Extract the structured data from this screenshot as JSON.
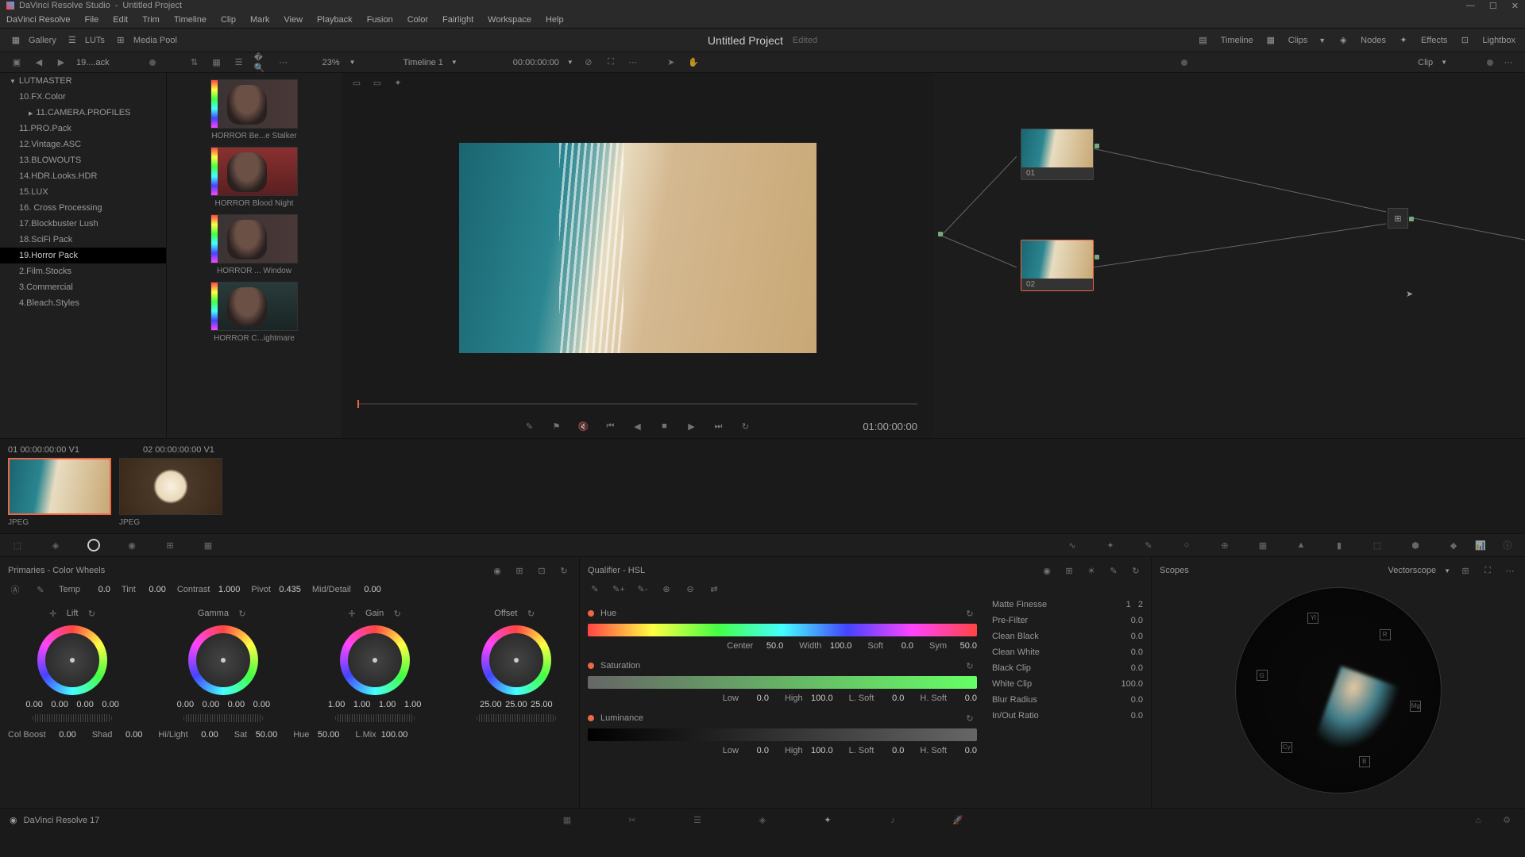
{
  "titlebar": {
    "app": "DaVinci Resolve Studio",
    "project": "Untitled Project"
  },
  "menu": [
    "DaVinci Resolve",
    "File",
    "Edit",
    "Trim",
    "Timeline",
    "Clip",
    "Mark",
    "View",
    "Playback",
    "Fusion",
    "Color",
    "Fairlight",
    "Workspace",
    "Help"
  ],
  "toolbar": {
    "gallery": "Gallery",
    "luts": "LUTs",
    "mediapool": "Media Pool",
    "title": "Untitled Project",
    "edited": "Edited",
    "timeline": "Timeline",
    "clips": "Clips",
    "nodes": "Nodes",
    "effects": "Effects",
    "lightbox": "Lightbox"
  },
  "subbar": {
    "path": "19....ack",
    "zoom": "23%",
    "timeline": "Timeline 1",
    "tc": "00:00:00:00",
    "clip": "Clip"
  },
  "tree": {
    "root": "LUTMASTER",
    "items": [
      "10.FX.Color",
      "11.CAMERA.PROFILES",
      "11.PRO.Pack",
      "12.Vintage.ASC",
      "13.BLOWOUTS",
      "14.HDR.Looks.HDR",
      "15.LUX",
      "16. Cross Processing",
      "17.Blockbuster Lush",
      "18.SciFi Pack",
      "19.Horror Pack",
      "2.Film.Stocks",
      "3.Commercial",
      "4.Bleach.Styles"
    ],
    "active": 10
  },
  "luts": [
    "HORROR Be...e Stalker",
    "HORROR Blood Night",
    "HORROR ... Window",
    "HORROR C...ightmare"
  ],
  "transport": {
    "tc": "01:00:00:00"
  },
  "nodes": {
    "n1": "01",
    "n2": "02"
  },
  "clips": {
    "info1": {
      "num": "01",
      "tc": "00:00:00:00",
      "track": "V1"
    },
    "info2": {
      "num": "02",
      "tc": "00:00:00:00",
      "track": "V1"
    },
    "type": "JPEG"
  },
  "primaries": {
    "title": "Primaries - Color Wheels",
    "params": {
      "temp_l": "Temp",
      "temp": "0.0",
      "tint_l": "Tint",
      "tint": "0.00",
      "contrast_l": "Contrast",
      "contrast": "1.000",
      "pivot_l": "Pivot",
      "pivot": "0.435",
      "middetail_l": "Mid/Detail",
      "middetail": "0.00"
    },
    "wheels": {
      "lift": {
        "label": "Lift",
        "v": [
          "0.00",
          "0.00",
          "0.00",
          "0.00"
        ]
      },
      "gamma": {
        "label": "Gamma",
        "v": [
          "0.00",
          "0.00",
          "0.00",
          "0.00"
        ]
      },
      "gain": {
        "label": "Gain",
        "v": [
          "1.00",
          "1.00",
          "1.00",
          "1.00"
        ]
      },
      "offset": {
        "label": "Offset",
        "v": [
          "25.00",
          "25.00",
          "25.00"
        ]
      }
    },
    "bottom": {
      "colboost_l": "Col Boost",
      "colboost": "0.00",
      "shad_l": "Shad",
      "shad": "0.00",
      "hilight_l": "Hi/Light",
      "hilight": "0.00",
      "sat_l": "Sat",
      "sat": "50.00",
      "hue_l": "Hue",
      "hue": "50.00",
      "lmix_l": "L.Mix",
      "lmix": "100.00"
    }
  },
  "qualifier": {
    "title": "Qualifier - HSL",
    "hue": {
      "label": "Hue",
      "center_l": "Center",
      "center": "50.0",
      "width_l": "Width",
      "width": "100.0",
      "soft_l": "Soft",
      "soft": "0.0",
      "sym_l": "Sym",
      "sym": "50.0"
    },
    "sat": {
      "label": "Saturation",
      "low_l": "Low",
      "low": "0.0",
      "high_l": "High",
      "high": "100.0",
      "lsoft_l": "L. Soft",
      "lsoft": "0.0",
      "hsoft_l": "H. Soft",
      "hsoft": "0.0"
    },
    "lum": {
      "label": "Luminance",
      "low_l": "Low",
      "low": "0.0",
      "high_l": "High",
      "high": "100.0",
      "lsoft_l": "L. Soft",
      "lsoft": "0.0",
      "hsoft_l": "H. Soft",
      "hsoft": "0.0"
    }
  },
  "matte": {
    "title": "Matte Finesse",
    "tab1": "1",
    "tab2": "2",
    "rows": [
      {
        "l": "Pre-Filter",
        "v": "0.0"
      },
      {
        "l": "Clean Black",
        "v": "0.0"
      },
      {
        "l": "Clean White",
        "v": "0.0"
      },
      {
        "l": "Black Clip",
        "v": "0.0"
      },
      {
        "l": "White Clip",
        "v": "100.0"
      },
      {
        "l": "Blur Radius",
        "v": "0.0"
      },
      {
        "l": "In/Out Ratio",
        "v": "0.0"
      }
    ]
  },
  "scopes": {
    "title": "Scopes",
    "type": "Vectorscope"
  },
  "footer": {
    "version": "DaVinci Resolve 17"
  }
}
